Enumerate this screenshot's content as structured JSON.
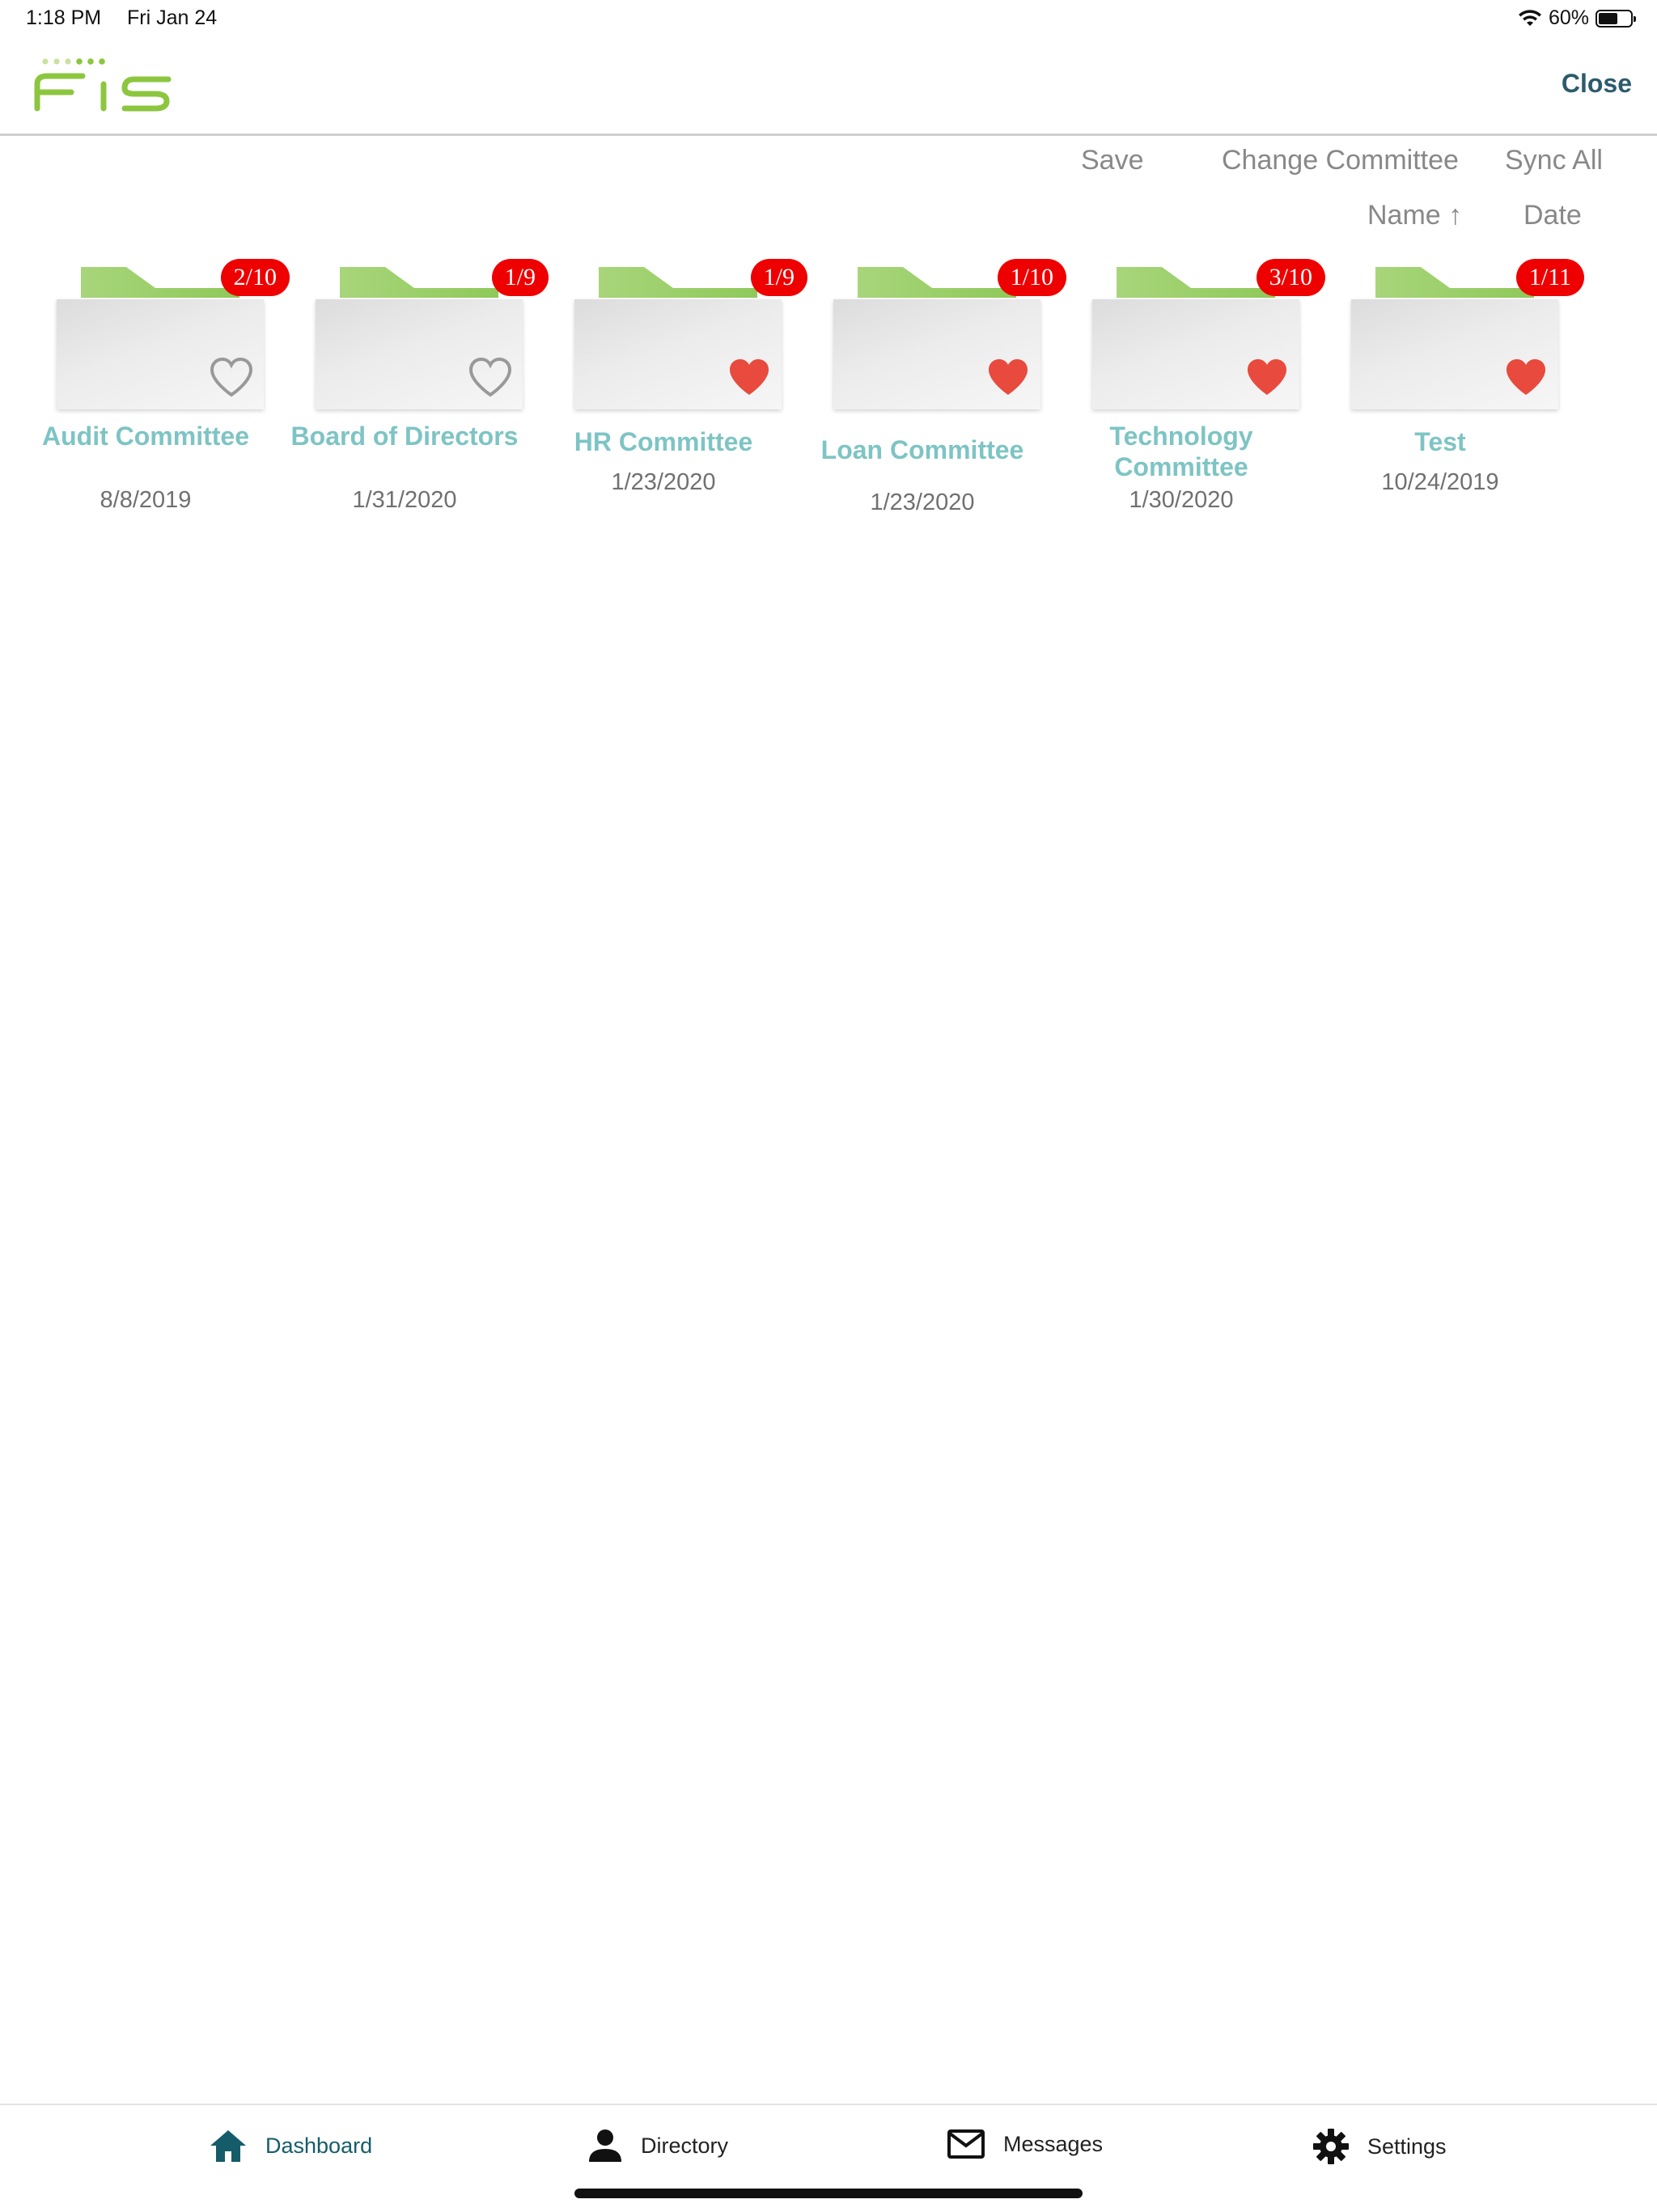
{
  "status": {
    "time": "1:18 PM",
    "date": "Fri Jan 24",
    "battery_text": "60%",
    "battery_level": 0.6
  },
  "header": {
    "logo_text": "FIS",
    "close_label": "Close"
  },
  "toolbar": {
    "save_label": "Save",
    "change_committee_label": "Change Committee",
    "sync_all_label": "Sync All",
    "sort_name_label": "Name ↑",
    "sort_date_label": "Date"
  },
  "committees": [
    {
      "name": "Audit Committee",
      "date": "8/8/2019",
      "badge": "2/10",
      "favorite": false
    },
    {
      "name": "Board of Directors",
      "date": "1/31/2020",
      "badge": "1/9",
      "favorite": false
    },
    {
      "name": "HR Committee",
      "date": "1/23/2020",
      "badge": "1/9",
      "favorite": true
    },
    {
      "name": "Loan Committee",
      "date": "1/23/2020",
      "badge": "1/10",
      "favorite": true
    },
    {
      "name": "Technology Committee",
      "date": "1/30/2020",
      "badge": "3/10",
      "favorite": true
    },
    {
      "name": "Test",
      "date": "10/24/2019",
      "badge": "1/11",
      "favorite": true
    }
  ],
  "tabs": [
    {
      "label": "Dashboard",
      "icon": "home-icon",
      "active": true
    },
    {
      "label": "Directory",
      "icon": "person-icon",
      "active": false
    },
    {
      "label": "Messages",
      "icon": "mail-icon",
      "active": false
    },
    {
      "label": "Settings",
      "icon": "gear-icon",
      "active": false
    }
  ],
  "colors": {
    "accent": "#155c6a",
    "committee_name": "#7ec4c4",
    "badge": "#ee0000",
    "heart_filled": "#e84a3d",
    "heart_outline": "#999999",
    "logo_green": "#8cc63f"
  }
}
